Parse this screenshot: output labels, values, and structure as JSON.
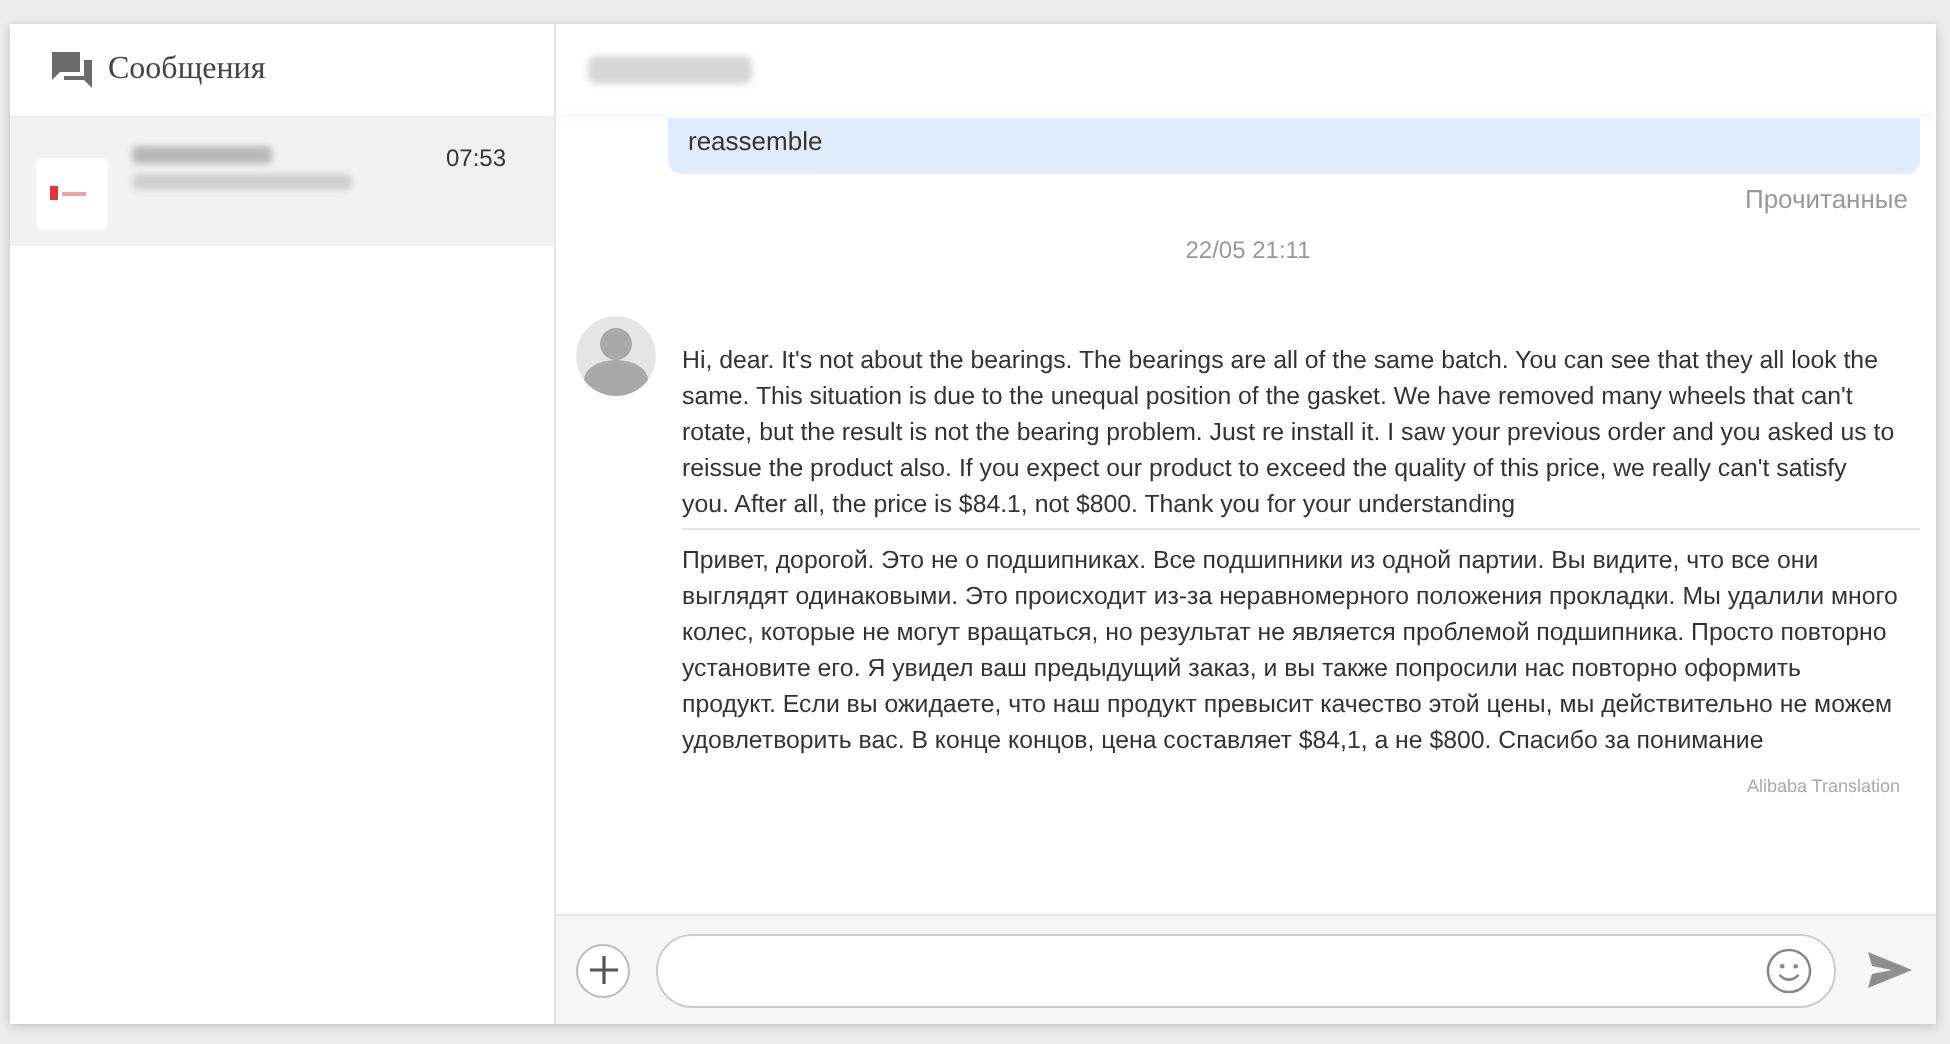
{
  "sidebar": {
    "title": "Сообщения",
    "conversations": [
      {
        "time": "07:53",
        "selected": true
      }
    ]
  },
  "chat": {
    "messages": [
      {
        "kind": "sent",
        "text": "reassemble",
        "status": "Прочитанные"
      },
      {
        "kind": "time",
        "text": "22/05 21:11"
      },
      {
        "kind": "received",
        "text": "Hi, dear. It's not about the bearings. The bearings are all of the same batch. You can see that they all look the same. This situation is due to the unequal position of the gasket. We have removed many wheels that can't rotate, but the result is not the bearing problem. Just re install it. I saw your previous order and you asked us to reissue the product also. If you expect our product to exceed the quality of this price, we really can't satisfy you. After all, the price is $84.1, not $800. Thank you for your understanding",
        "translation": "Привет, дорогой. Это не о подшипниках. Все подшипники из одной партии. Вы видите, что все они выглядят одинаковыми. Это происходит из-за неравномерного положения прокладки. Мы удалили много колес, которые не могут вращаться, но результат не является проблемой подшипника. Просто повторно установите его. Я увидел ваш предыдущий заказ, и вы также попросили нас повторно оформить продукт. Если вы ожидаете, что наш продукт превысит качество этой цены, мы действительно не можем удовлетворить вас. В конце концов, цена составляет $84,1, а не $800. Спасибо за понимание",
        "translation_label": "Alibaba Translation"
      }
    ]
  }
}
